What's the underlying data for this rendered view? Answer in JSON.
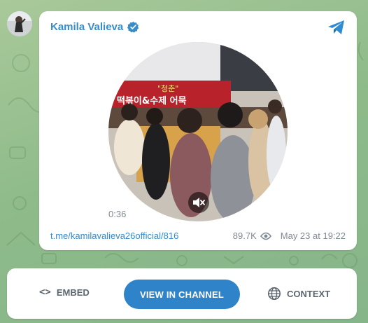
{
  "post": {
    "author": "Kamila Valieva",
    "duration": "0:36",
    "link": "t.me/kamilavalieva26official/816",
    "views": "89.7K",
    "date": "May 23 at 19:22",
    "video_signs": {
      "sign_top": "\"청춘\"",
      "sign_main": "떡볶이&수제 어묵"
    }
  },
  "actions": {
    "embed_label": "EMBED",
    "view_channel_label": "VIEW IN CHANNEL",
    "context_label": "CONTEXT"
  },
  "icons": {
    "verified": "verified-check-icon",
    "telegram": "telegram-plane-icon",
    "mute": "speaker-muted-icon",
    "views": "eye-icon",
    "embed": "code-brackets-icon",
    "context": "globe-icon"
  },
  "colors": {
    "accent": "#2f83c9",
    "author": "#3a8cc9",
    "link": "#2f8bd2",
    "meta": "#7e8a93",
    "background": "#8fbb8a"
  }
}
